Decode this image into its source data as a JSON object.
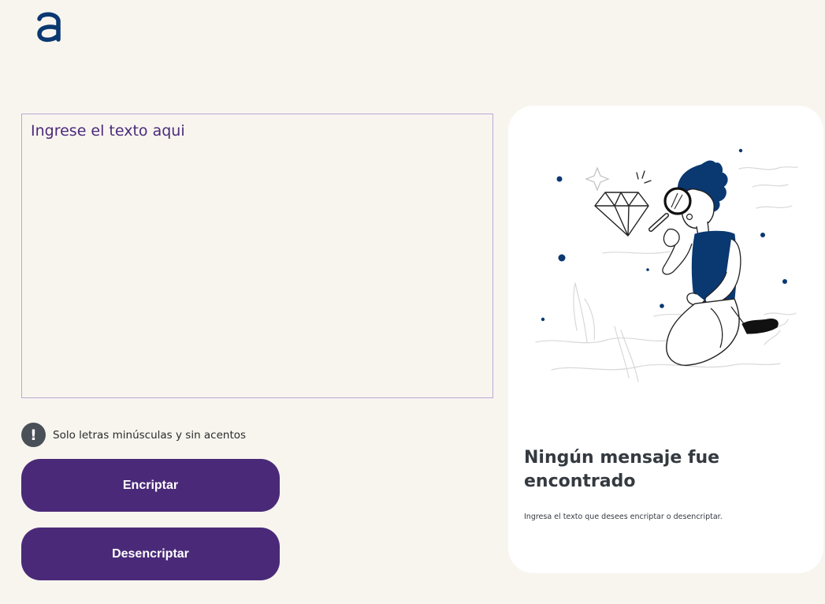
{
  "header": {
    "logo_icon": "alura-a-logo",
    "logo_color": "#0a3871"
  },
  "input": {
    "placeholder": "Ingrese el texto aqui",
    "value": ""
  },
  "notice": {
    "icon": "exclamation-icon",
    "text": "Solo letras minúsculas y sin acentos"
  },
  "buttons": {
    "encrypt_label": "Encriptar",
    "decrypt_label": "Desencriptar"
  },
  "output": {
    "illustration": "person-with-magnifying-glass-looking-at-diamond",
    "title": "Ningún mensaje fue encontrado",
    "subtitle": "Ingresa el texto que desees encriptar o desencriptar."
  },
  "colors": {
    "background": "#f8f5ef",
    "button": "#4a2a78",
    "accent": "#0a3871"
  }
}
